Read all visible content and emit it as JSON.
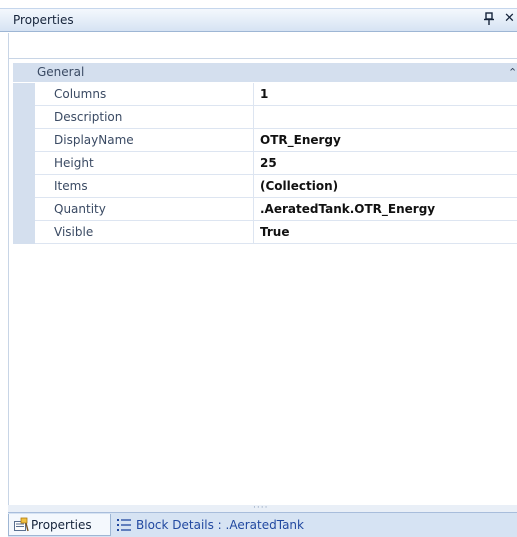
{
  "panel": {
    "title": "Properties",
    "pin_icon": "pin-icon",
    "close_icon": "close-icon",
    "close_glyph": "✕"
  },
  "grid": {
    "category": {
      "label": "General",
      "collapse_glyph": "⌃"
    },
    "properties": [
      {
        "name": "Columns",
        "value": "1"
      },
      {
        "name": "Description",
        "value": ""
      },
      {
        "name": "DisplayName",
        "value": "OTR_Energy"
      },
      {
        "name": "Height",
        "value": "25"
      },
      {
        "name": "Items",
        "value": "(Collection)"
      },
      {
        "name": "Quantity",
        "value": ".AeratedTank.OTR_Energy"
      },
      {
        "name": "Visible",
        "value": "True"
      }
    ]
  },
  "splitter": {
    "grip": "····"
  },
  "tabs": [
    {
      "label": "Properties",
      "icon": "properties-icon",
      "active": true
    },
    {
      "label": "Block Details : .AeratedTank",
      "icon": "list-icon",
      "active": false
    }
  ],
  "colors": {
    "title_gradient_top": "#f4f8fd",
    "title_gradient_bottom": "#d6e3f3",
    "category_bg": "#d4dfee",
    "tab_link": "#2148a0"
  }
}
